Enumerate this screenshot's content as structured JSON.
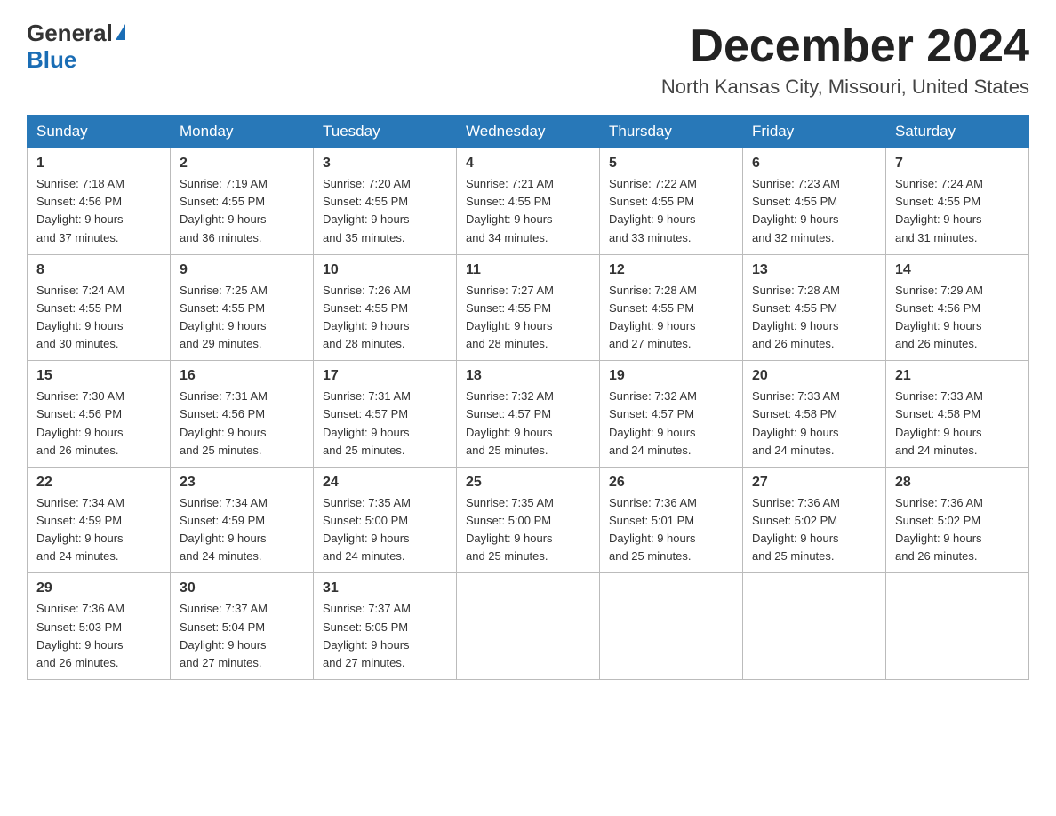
{
  "logo": {
    "general": "General",
    "triangle": "",
    "blue": "Blue",
    "subtitle": ""
  },
  "title": "December 2024",
  "location": "North Kansas City, Missouri, United States",
  "weekdays": [
    "Sunday",
    "Monday",
    "Tuesday",
    "Wednesday",
    "Thursday",
    "Friday",
    "Saturday"
  ],
  "weeks": [
    [
      {
        "day": "1",
        "sunrise": "7:18 AM",
        "sunset": "4:56 PM",
        "daylight": "9 hours and 37 minutes."
      },
      {
        "day": "2",
        "sunrise": "7:19 AM",
        "sunset": "4:55 PM",
        "daylight": "9 hours and 36 minutes."
      },
      {
        "day": "3",
        "sunrise": "7:20 AM",
        "sunset": "4:55 PM",
        "daylight": "9 hours and 35 minutes."
      },
      {
        "day": "4",
        "sunrise": "7:21 AM",
        "sunset": "4:55 PM",
        "daylight": "9 hours and 34 minutes."
      },
      {
        "day": "5",
        "sunrise": "7:22 AM",
        "sunset": "4:55 PM",
        "daylight": "9 hours and 33 minutes."
      },
      {
        "day": "6",
        "sunrise": "7:23 AM",
        "sunset": "4:55 PM",
        "daylight": "9 hours and 32 minutes."
      },
      {
        "day": "7",
        "sunrise": "7:24 AM",
        "sunset": "4:55 PM",
        "daylight": "9 hours and 31 minutes."
      }
    ],
    [
      {
        "day": "8",
        "sunrise": "7:24 AM",
        "sunset": "4:55 PM",
        "daylight": "9 hours and 30 minutes."
      },
      {
        "day": "9",
        "sunrise": "7:25 AM",
        "sunset": "4:55 PM",
        "daylight": "9 hours and 29 minutes."
      },
      {
        "day": "10",
        "sunrise": "7:26 AM",
        "sunset": "4:55 PM",
        "daylight": "9 hours and 28 minutes."
      },
      {
        "day": "11",
        "sunrise": "7:27 AM",
        "sunset": "4:55 PM",
        "daylight": "9 hours and 28 minutes."
      },
      {
        "day": "12",
        "sunrise": "7:28 AM",
        "sunset": "4:55 PM",
        "daylight": "9 hours and 27 minutes."
      },
      {
        "day": "13",
        "sunrise": "7:28 AM",
        "sunset": "4:55 PM",
        "daylight": "9 hours and 26 minutes."
      },
      {
        "day": "14",
        "sunrise": "7:29 AM",
        "sunset": "4:56 PM",
        "daylight": "9 hours and 26 minutes."
      }
    ],
    [
      {
        "day": "15",
        "sunrise": "7:30 AM",
        "sunset": "4:56 PM",
        "daylight": "9 hours and 26 minutes."
      },
      {
        "day": "16",
        "sunrise": "7:31 AM",
        "sunset": "4:56 PM",
        "daylight": "9 hours and 25 minutes."
      },
      {
        "day": "17",
        "sunrise": "7:31 AM",
        "sunset": "4:57 PM",
        "daylight": "9 hours and 25 minutes."
      },
      {
        "day": "18",
        "sunrise": "7:32 AM",
        "sunset": "4:57 PM",
        "daylight": "9 hours and 25 minutes."
      },
      {
        "day": "19",
        "sunrise": "7:32 AM",
        "sunset": "4:57 PM",
        "daylight": "9 hours and 24 minutes."
      },
      {
        "day": "20",
        "sunrise": "7:33 AM",
        "sunset": "4:58 PM",
        "daylight": "9 hours and 24 minutes."
      },
      {
        "day": "21",
        "sunrise": "7:33 AM",
        "sunset": "4:58 PM",
        "daylight": "9 hours and 24 minutes."
      }
    ],
    [
      {
        "day": "22",
        "sunrise": "7:34 AM",
        "sunset": "4:59 PM",
        "daylight": "9 hours and 24 minutes."
      },
      {
        "day": "23",
        "sunrise": "7:34 AM",
        "sunset": "4:59 PM",
        "daylight": "9 hours and 24 minutes."
      },
      {
        "day": "24",
        "sunrise": "7:35 AM",
        "sunset": "5:00 PM",
        "daylight": "9 hours and 24 minutes."
      },
      {
        "day": "25",
        "sunrise": "7:35 AM",
        "sunset": "5:00 PM",
        "daylight": "9 hours and 25 minutes."
      },
      {
        "day": "26",
        "sunrise": "7:36 AM",
        "sunset": "5:01 PM",
        "daylight": "9 hours and 25 minutes."
      },
      {
        "day": "27",
        "sunrise": "7:36 AM",
        "sunset": "5:02 PM",
        "daylight": "9 hours and 25 minutes."
      },
      {
        "day": "28",
        "sunrise": "7:36 AM",
        "sunset": "5:02 PM",
        "daylight": "9 hours and 26 minutes."
      }
    ],
    [
      {
        "day": "29",
        "sunrise": "7:36 AM",
        "sunset": "5:03 PM",
        "daylight": "9 hours and 26 minutes."
      },
      {
        "day": "30",
        "sunrise": "7:37 AM",
        "sunset": "5:04 PM",
        "daylight": "9 hours and 27 minutes."
      },
      {
        "day": "31",
        "sunrise": "7:37 AM",
        "sunset": "5:05 PM",
        "daylight": "9 hours and 27 minutes."
      },
      null,
      null,
      null,
      null
    ]
  ],
  "labels": {
    "sunrise": "Sunrise:",
    "sunset": "Sunset:",
    "daylight": "Daylight:"
  }
}
